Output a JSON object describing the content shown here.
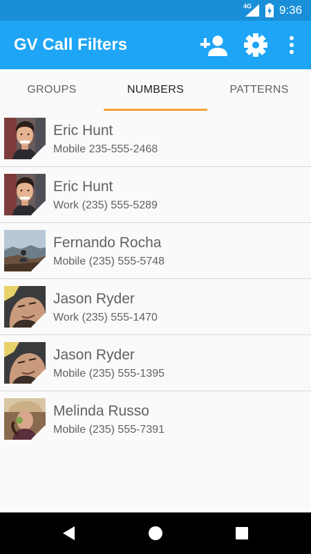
{
  "status_bar": {
    "network": "4G",
    "time": "9:36"
  },
  "app_bar": {
    "title": "GV Call Filters",
    "icons": [
      "add-person-icon",
      "settings-icon",
      "more-vert-icon"
    ],
    "color": "#1fa5f5"
  },
  "tabs": [
    {
      "label": "GROUPS",
      "active": false
    },
    {
      "label": "NUMBERS",
      "active": true
    },
    {
      "label": "PATTERNS",
      "active": false
    }
  ],
  "accent_color": "#f5a138",
  "contacts": [
    {
      "name": "Eric Hunt",
      "type": "Mobile",
      "number": "235-555-2468",
      "avatar": "eric-hunt"
    },
    {
      "name": "Eric Hunt",
      "type": "Work",
      "number": "(235) 555-5289",
      "avatar": "eric-hunt"
    },
    {
      "name": "Fernando Rocha",
      "type": "Mobile",
      "number": "(235) 555-5748",
      "avatar": "fernando-rocha"
    },
    {
      "name": "Jason Ryder",
      "type": "Work",
      "number": "(235) 555-1470",
      "avatar": "jason-ryder"
    },
    {
      "name": "Jason Ryder",
      "type": "Mobile",
      "number": "(235) 555-1395",
      "avatar": "jason-ryder"
    },
    {
      "name": "Melinda Russo",
      "type": "Mobile",
      "number": "(235) 555-7391",
      "avatar": "melinda-russo"
    }
  ],
  "nav_bar": {
    "icons": [
      "back-icon",
      "home-icon",
      "recents-icon"
    ]
  }
}
